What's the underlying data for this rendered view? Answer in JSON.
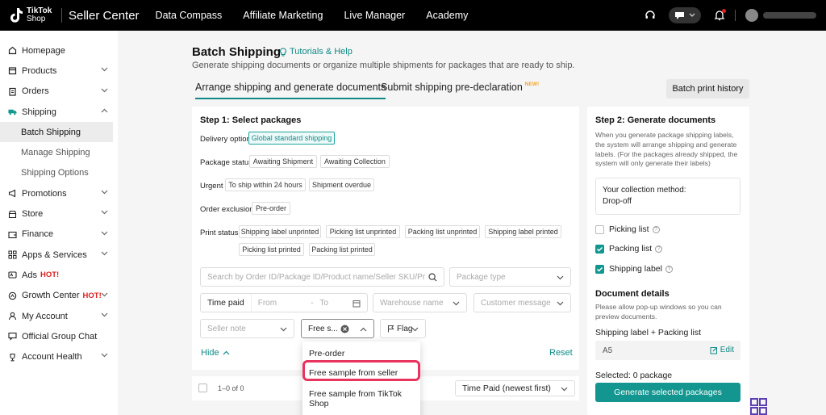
{
  "topbar": {
    "logo_line1": "TikTok",
    "logo_line2": "Shop",
    "brand": "Seller Center",
    "nav": [
      "Data Compass",
      "Affiliate Marketing",
      "Live Manager",
      "Academy"
    ]
  },
  "sidebar": {
    "items": [
      {
        "label": "Homepage",
        "icon": "home-icon"
      },
      {
        "label": "Products",
        "icon": "box-icon"
      },
      {
        "label": "Orders",
        "icon": "clipboard-icon"
      },
      {
        "label": "Shipping",
        "icon": "truck-icon"
      },
      {
        "label": "Batch Shipping"
      },
      {
        "label": "Manage Shipping"
      },
      {
        "label": "Shipping Options"
      },
      {
        "label": "Promotions",
        "icon": "megaphone-icon"
      },
      {
        "label": "Store",
        "icon": "store-icon"
      },
      {
        "label": "Finance",
        "icon": "wallet-icon"
      },
      {
        "label": "Apps & Services",
        "icon": "apps-icon"
      },
      {
        "label": "Ads",
        "icon": "ads-icon",
        "badge": "HOT!"
      },
      {
        "label": "Growth Center",
        "icon": "growth-icon",
        "badge": "HOT!"
      },
      {
        "label": "My Account",
        "icon": "user-icon"
      },
      {
        "label": "Official Group Chat",
        "icon": "chat-icon"
      },
      {
        "label": "Account Health",
        "icon": "trophy-icon"
      }
    ]
  },
  "page": {
    "title": "Batch Shipping",
    "tutorials": "Tutorials & Help",
    "subtitle": "Generate shipping documents or organize multiple shipments for packages that are ready to ship.",
    "tabs": [
      "Arrange shipping and generate documents",
      "Submit shipping pre-declaration"
    ],
    "new_badge": "NEW!",
    "batch_print_history": "Batch print history"
  },
  "step1": {
    "title": "Step 1: Select packages",
    "delivery_label": "Delivery option",
    "delivery_chip": "Global standard shipping",
    "package_status_label": "Package status",
    "package_status_chips": [
      "Awaiting Shipment",
      "Awaiting Collection"
    ],
    "urgent_label": "Urgent",
    "urgent_chips": [
      "To ship within 24 hours",
      "Shipment overdue"
    ],
    "order_exclusion_label": "Order exclusion",
    "order_exclusion_chip": "Pre-order",
    "print_status_label": "Print status",
    "print_chips_row1": [
      "Shipping label unprinted",
      "Picking list unprinted",
      "Packing list unprinted",
      "Shipping label printed"
    ],
    "print_chips_row2": [
      "Picking list printed",
      "Packing list printed"
    ],
    "search_placeholder": "Search by Order ID/Package ID/Product name/Seller SKU/Product",
    "package_type": "Package type",
    "time_paid": "Time paid",
    "from": "From",
    "dash": "-",
    "to": "To",
    "warehouse": "Warehouse name",
    "customer_message": "Customer message",
    "seller_note": "Seller note",
    "free_sample_value": "Free s...",
    "flag": "Flag",
    "hide": "Hide",
    "reset": "Reset"
  },
  "dropdown": {
    "options": [
      "Pre-order",
      "Free sample from seller",
      "Free sample from TikTok Shop"
    ]
  },
  "list": {
    "count": "1–0 of 0",
    "sort": "Time Paid (newest first)"
  },
  "step2": {
    "title": "Step 2: Generate documents",
    "desc": "When you generate package shipping labels, the system will arrange shipping and generate labels. (For the packages already shipped, the system will only generate their labels)",
    "collection_label": "Your collection method:",
    "collection_value": "Drop-off",
    "options": [
      {
        "label": "Picking list",
        "checked": false
      },
      {
        "label": "Packing list",
        "checked": true
      },
      {
        "label": "Shipping label",
        "checked": true
      }
    ],
    "doc_title": "Document details",
    "doc_desc": "Please allow pop-up windows so you can preview documents.",
    "doc_type": "Shipping label + Packing list",
    "size": "A5",
    "edit": "Edit",
    "selected": "Selected: 0 package",
    "generate": "Generate selected packages"
  },
  "colors": {
    "accent": "#12968f",
    "highlight": "#e8345e",
    "hot": "#e02020"
  }
}
